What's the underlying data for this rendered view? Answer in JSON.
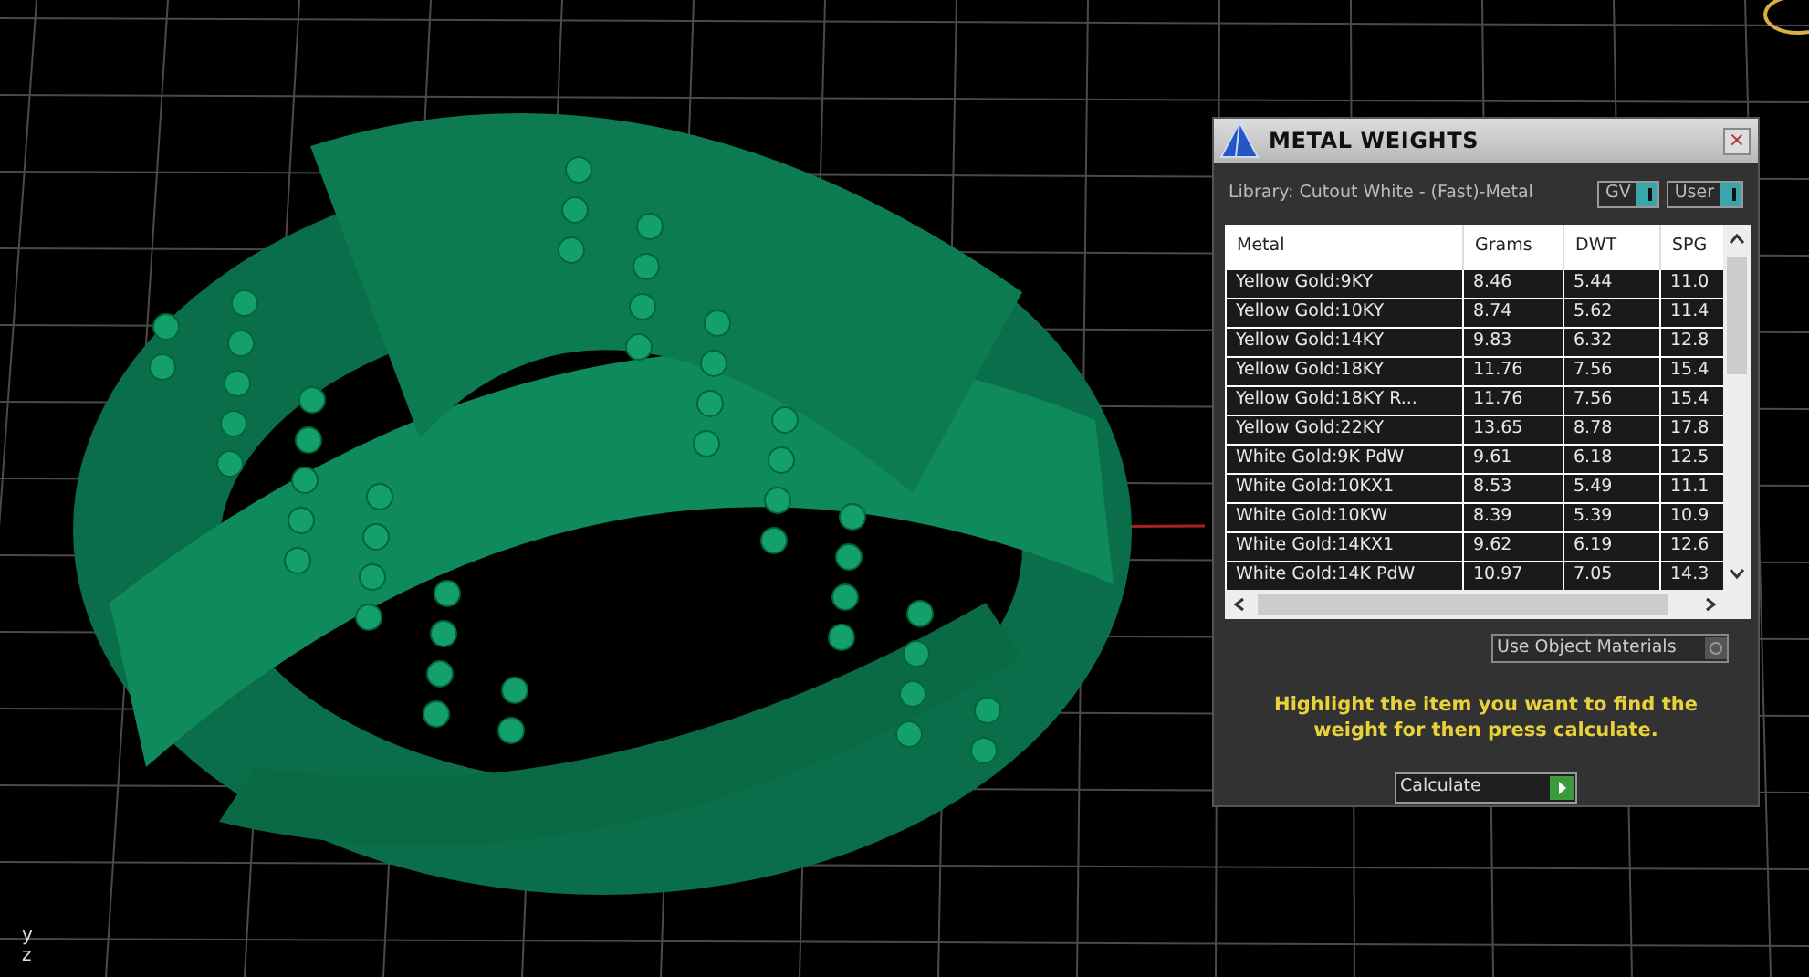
{
  "viewport": {
    "axis_labels": [
      "y",
      "z"
    ]
  },
  "panel": {
    "title": "METAL WEIGHTS",
    "close": "×",
    "library": "Library: Cutout White - (Fast)-Metal",
    "switches": [
      {
        "label": "GV",
        "on": true
      },
      {
        "label": "User",
        "on": true
      }
    ],
    "table": {
      "columns": [
        "Metal",
        "Grams",
        "DWT",
        "SPG"
      ],
      "rows": [
        {
          "cells": [
            "Yellow Gold:9KY",
            "8.46",
            "5.44",
            "11.0"
          ],
          "selected": false
        },
        {
          "cells": [
            "Yellow Gold:10KY",
            "8.74",
            "5.62",
            "11.4"
          ],
          "selected": false
        },
        {
          "cells": [
            "Yellow Gold:14KY",
            "9.83",
            "6.32",
            "12.8"
          ],
          "selected": false
        },
        {
          "cells": [
            "Yellow Gold:18KY",
            "11.76",
            "7.56",
            "15.4"
          ],
          "selected": false
        },
        {
          "cells": [
            "Yellow Gold:18KY R...",
            "11.76",
            "7.56",
            "15.4"
          ],
          "selected": false
        },
        {
          "cells": [
            "Yellow Gold:22KY",
            "13.65",
            "8.78",
            "17.8"
          ],
          "selected": false
        },
        {
          "cells": [
            "White Gold:9K PdW",
            "9.61",
            "6.18",
            "12.5"
          ],
          "selected": false
        },
        {
          "cells": [
            "White Gold:10KX1",
            "8.53",
            "5.49",
            "11.1"
          ],
          "selected": false
        },
        {
          "cells": [
            "White Gold:10KW",
            "8.39",
            "5.39",
            "10.9"
          ],
          "selected": false
        },
        {
          "cells": [
            "White Gold:14KX1",
            "9.62",
            "6.19",
            "12.6"
          ],
          "selected": false
        },
        {
          "cells": [
            "White Gold:14K PdW",
            "10.97",
            "7.05",
            "14.3"
          ],
          "selected": false
        }
      ]
    },
    "use_object_materials": {
      "label": "Use Object Materials",
      "on": false
    },
    "hint": "Highlight the item you want to find the weight for then press calculate.",
    "calculate_button": "Calculate"
  }
}
